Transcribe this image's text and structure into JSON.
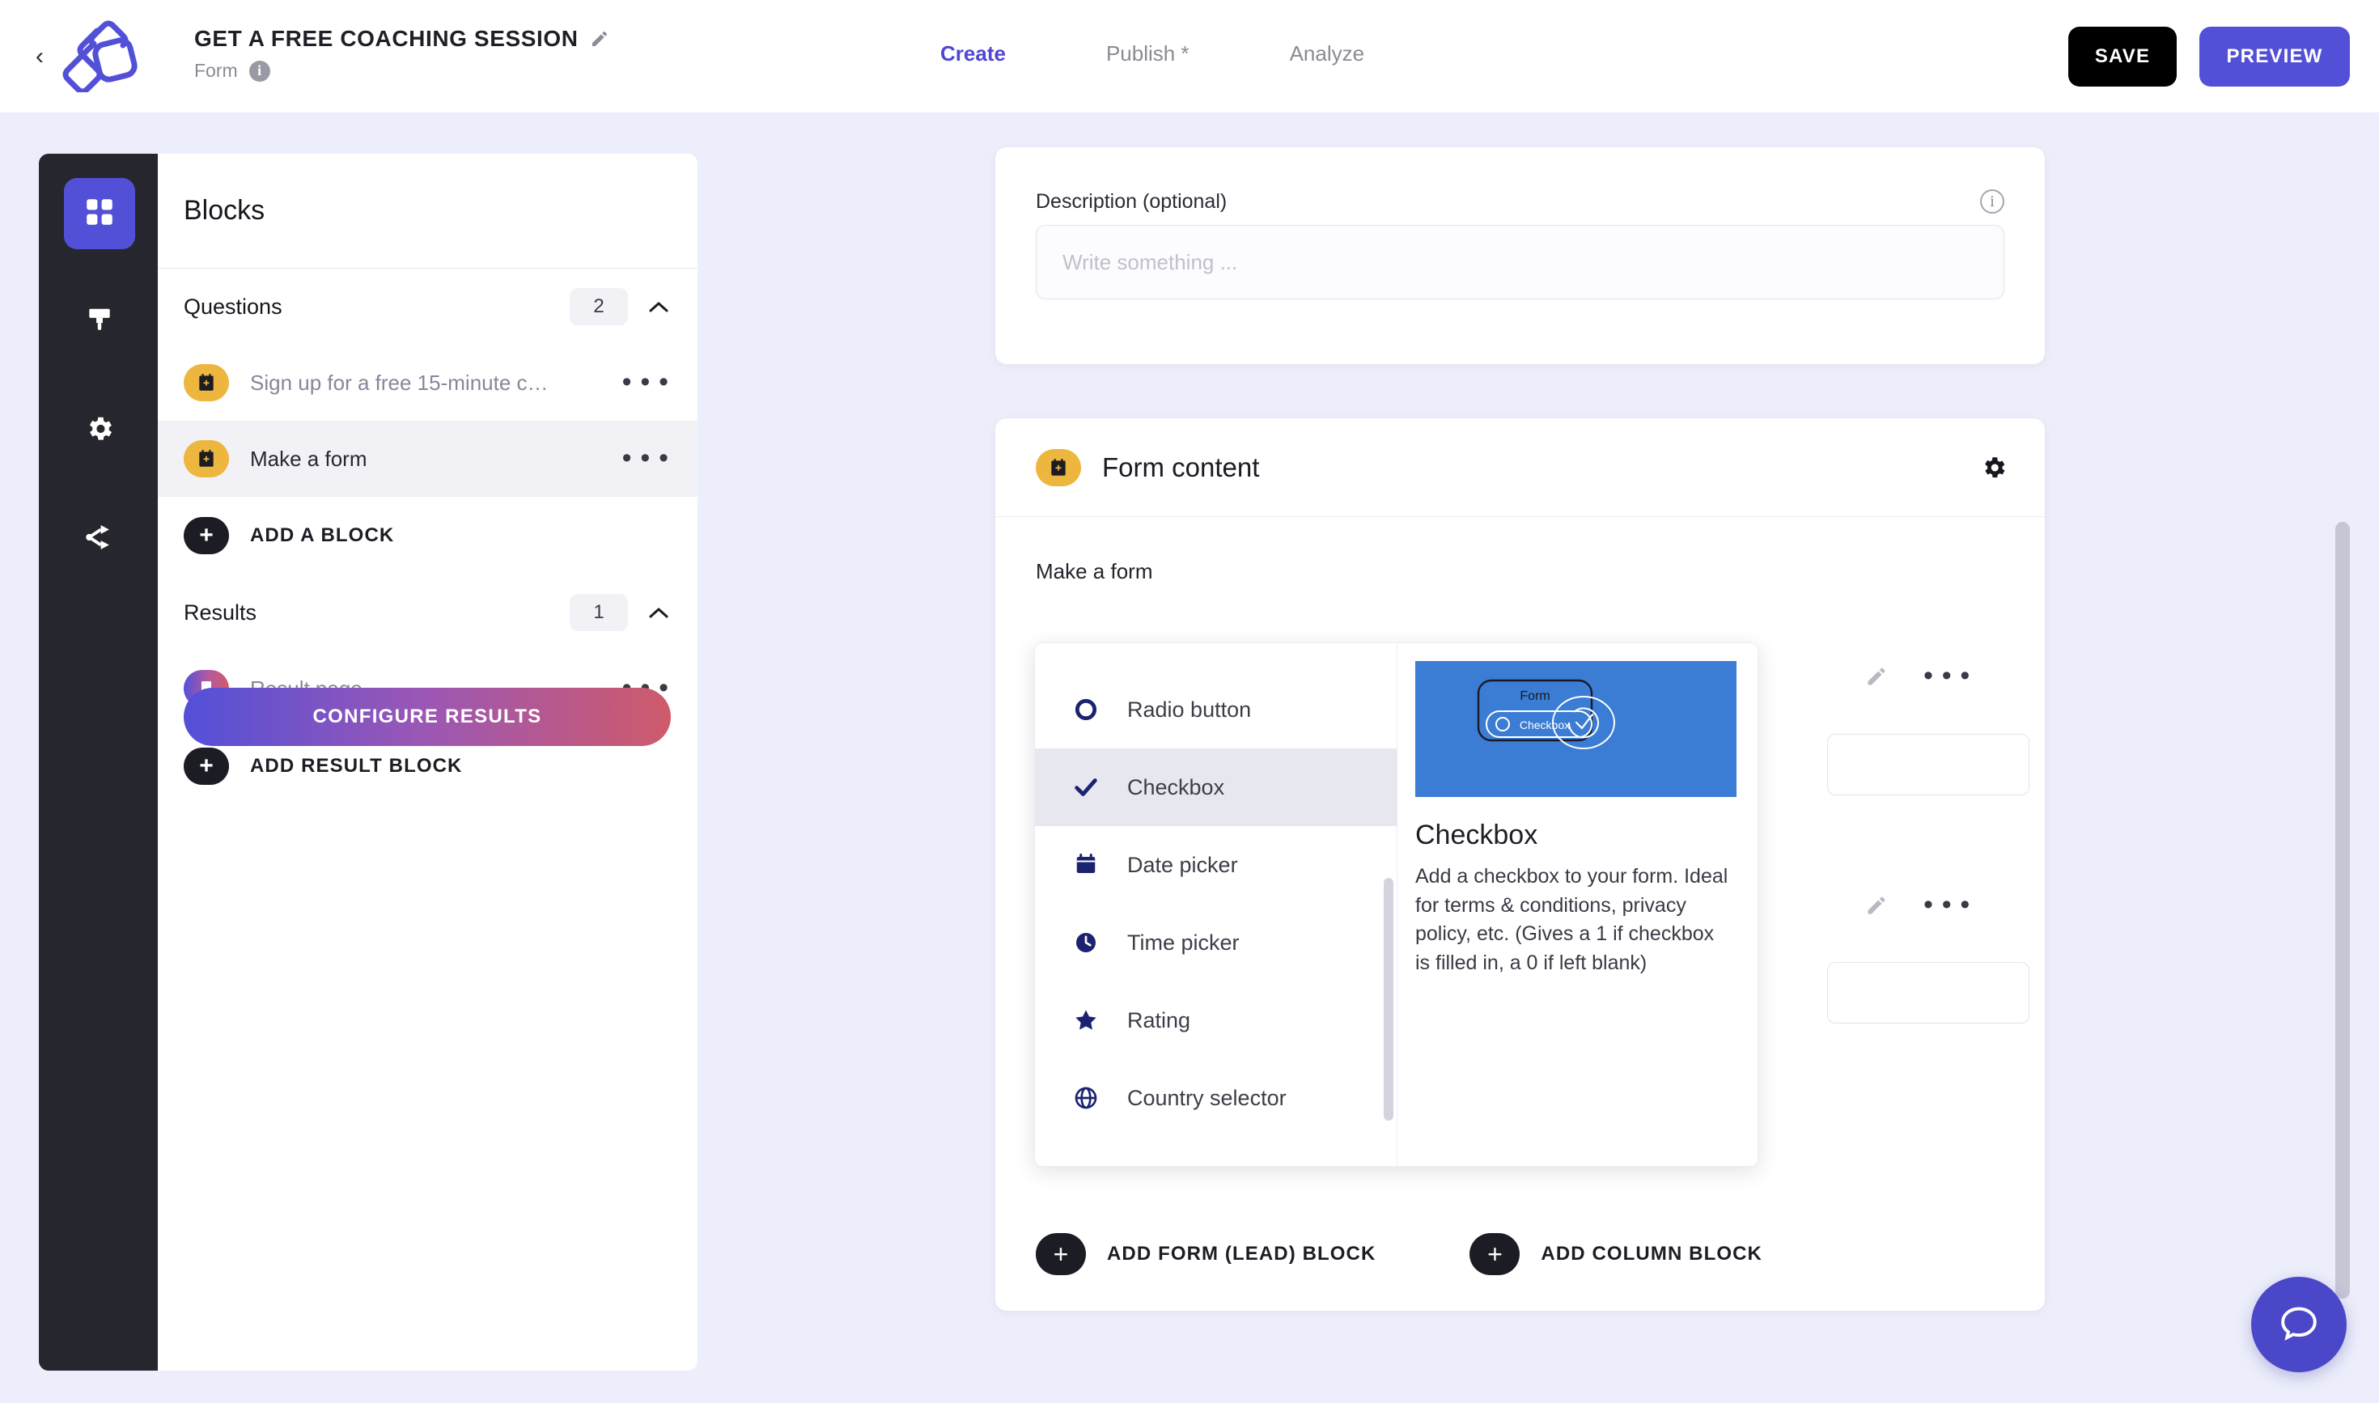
{
  "header": {
    "back_label": "‹",
    "logo_name": "involve-me-logo",
    "form_title": "GET A FREE COACHING SESSION",
    "form_subtitle": "Form",
    "info_glyph": "i",
    "tabs": [
      {
        "label": "Create",
        "active": true
      },
      {
        "label": "Publish *",
        "active": false
      },
      {
        "label": "Analyze",
        "active": false
      }
    ],
    "save_label": "SAVE",
    "preview_label": "PREVIEW"
  },
  "rail": {
    "items": [
      {
        "name": "blocks",
        "icon": "grid-icon",
        "active": true
      },
      {
        "name": "design",
        "icon": "paintbrush-icon",
        "active": false
      },
      {
        "name": "settings",
        "icon": "gear-icon",
        "active": false
      },
      {
        "name": "logic",
        "icon": "share-nodes-icon",
        "active": false
      }
    ]
  },
  "blocks_panel": {
    "title": "Blocks",
    "questions": {
      "label": "Questions",
      "count": "2",
      "items": [
        {
          "label": "Sign up for a free 15-minute c…",
          "icon": "calendar-plus-icon",
          "selected": false
        },
        {
          "label": "Make a form",
          "icon": "calendar-plus-icon",
          "selected": true
        }
      ],
      "add_label": "ADD A BLOCK"
    },
    "results": {
      "label": "Results",
      "count": "1",
      "items": [
        {
          "label": "Result page",
          "icon": "bookmark-icon",
          "selected": false
        }
      ],
      "add_label": "ADD RESULT BLOCK"
    },
    "configure_label": "CONFIGURE RESULTS",
    "menu_dots": "• • •"
  },
  "description_card": {
    "label": "Description (optional)",
    "placeholder": "Write something ...",
    "value": "",
    "info_glyph": "i"
  },
  "form_card": {
    "title": "Form content",
    "icon": "calendar-plus-icon",
    "body_label": "Make a form",
    "add_form_label": "ADD FORM (LEAD) BLOCK",
    "add_column_label": "ADD COLUMN BLOCK",
    "row_dots": "• • •"
  },
  "field_dropdown": {
    "items": [
      {
        "label": "Radio button",
        "icon": "radio-circle-icon",
        "selected": false
      },
      {
        "label": "Checkbox",
        "icon": "check-icon",
        "selected": true
      },
      {
        "label": "Date picker",
        "icon": "calendar-icon",
        "selected": false
      },
      {
        "label": "Time picker",
        "icon": "clock-icon",
        "selected": false
      },
      {
        "label": "Rating",
        "icon": "star-icon",
        "selected": false
      },
      {
        "label": "Country selector",
        "icon": "globe-icon",
        "selected": false
      }
    ],
    "preview": {
      "thumb_form_label": "Form",
      "thumb_checkbox_label": "Checkbox",
      "title": "Checkbox",
      "description": "Add a checkbox to your form. Ideal for terms & conditions, privacy policy, etc. (Gives a 1 if checkbox is filled in, a 0 if left blank)"
    }
  },
  "chat": {
    "icon": "chat-bubble-icon"
  },
  "colors": {
    "accent": "#5350d8",
    "canvas_bg": "#eceefb",
    "rail_bg": "#26262e",
    "chip_yellow": "#edb63f",
    "dropdown_icon": "#1c2270",
    "thumb_blue": "#3b7cd4"
  }
}
